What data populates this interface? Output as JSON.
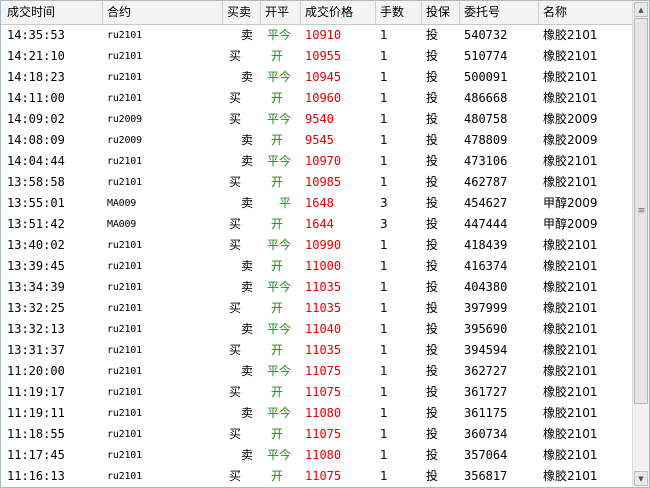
{
  "columns": [
    "成交时间",
    "合约",
    "买卖",
    "开平",
    "成交价格",
    "手数",
    "投保",
    "委托号",
    "名称"
  ],
  "rows": [
    {
      "time": "14:35:53",
      "contract": "ru2101",
      "side": "卖",
      "oc": "平今",
      "price": "10910",
      "qty": "1",
      "hedge": "投",
      "order_id": "540732",
      "name": "橡胶2101"
    },
    {
      "time": "14:21:10",
      "contract": "ru2101",
      "side": "买",
      "oc": "开",
      "price": "10955",
      "qty": "1",
      "hedge": "投",
      "order_id": "510774",
      "name": "橡胶2101"
    },
    {
      "time": "14:18:23",
      "contract": "ru2101",
      "side": "卖",
      "oc": "平今",
      "price": "10945",
      "qty": "1",
      "hedge": "投",
      "order_id": "500091",
      "name": "橡胶2101"
    },
    {
      "time": "14:11:00",
      "contract": "ru2101",
      "side": "买",
      "oc": "开",
      "price": "10960",
      "qty": "1",
      "hedge": "投",
      "order_id": "486668",
      "name": "橡胶2101"
    },
    {
      "time": "14:09:02",
      "contract": "ru2009",
      "side": "买",
      "oc": "平今",
      "price": "9540",
      "qty": "1",
      "hedge": "投",
      "order_id": "480758",
      "name": "橡胶2009"
    },
    {
      "time": "14:08:09",
      "contract": "ru2009",
      "side": "卖",
      "oc": "开",
      "price": "9545",
      "qty": "1",
      "hedge": "投",
      "order_id": "478809",
      "name": "橡胶2009"
    },
    {
      "time": "14:04:44",
      "contract": "ru2101",
      "side": "卖",
      "oc": "平今",
      "price": "10970",
      "qty": "1",
      "hedge": "投",
      "order_id": "473106",
      "name": "橡胶2101"
    },
    {
      "time": "13:58:58",
      "contract": "ru2101",
      "side": "买",
      "oc": "开",
      "price": "10985",
      "qty": "1",
      "hedge": "投",
      "order_id": "462787",
      "name": "橡胶2101"
    },
    {
      "time": "13:55:01",
      "contract": "MA009",
      "side": "卖",
      "oc": "平",
      "price": "1648",
      "qty": "3",
      "hedge": "投",
      "order_id": "454627",
      "name": "甲醇2009"
    },
    {
      "time": "13:51:42",
      "contract": "MA009",
      "side": "买",
      "oc": "开",
      "price": "1644",
      "qty": "3",
      "hedge": "投",
      "order_id": "447444",
      "name": "甲醇2009"
    },
    {
      "time": "13:40:02",
      "contract": "ru2101",
      "side": "买",
      "oc": "平今",
      "price": "10990",
      "qty": "1",
      "hedge": "投",
      "order_id": "418439",
      "name": "橡胶2101"
    },
    {
      "time": "13:39:45",
      "contract": "ru2101",
      "side": "卖",
      "oc": "开",
      "price": "11000",
      "qty": "1",
      "hedge": "投",
      "order_id": "416374",
      "name": "橡胶2101"
    },
    {
      "time": "13:34:39",
      "contract": "ru2101",
      "side": "卖",
      "oc": "平今",
      "price": "11035",
      "qty": "1",
      "hedge": "投",
      "order_id": "404380",
      "name": "橡胶2101"
    },
    {
      "time": "13:32:25",
      "contract": "ru2101",
      "side": "买",
      "oc": "开",
      "price": "11035",
      "qty": "1",
      "hedge": "投",
      "order_id": "397999",
      "name": "橡胶2101"
    },
    {
      "time": "13:32:13",
      "contract": "ru2101",
      "side": "卖",
      "oc": "平今",
      "price": "11040",
      "qty": "1",
      "hedge": "投",
      "order_id": "395690",
      "name": "橡胶2101"
    },
    {
      "time": "13:31:37",
      "contract": "ru2101",
      "side": "买",
      "oc": "开",
      "price": "11035",
      "qty": "1",
      "hedge": "投",
      "order_id": "394594",
      "name": "橡胶2101"
    },
    {
      "time": "11:20:00",
      "contract": "ru2101",
      "side": "卖",
      "oc": "平今",
      "price": "11075",
      "qty": "1",
      "hedge": "投",
      "order_id": "362727",
      "name": "橡胶2101"
    },
    {
      "time": "11:19:17",
      "contract": "ru2101",
      "side": "买",
      "oc": "开",
      "price": "11075",
      "qty": "1",
      "hedge": "投",
      "order_id": "361727",
      "name": "橡胶2101"
    },
    {
      "time": "11:19:11",
      "contract": "ru2101",
      "side": "卖",
      "oc": "平今",
      "price": "11080",
      "qty": "1",
      "hedge": "投",
      "order_id": "361175",
      "name": "橡胶2101"
    },
    {
      "time": "11:18:55",
      "contract": "ru2101",
      "side": "买",
      "oc": "开",
      "price": "11075",
      "qty": "1",
      "hedge": "投",
      "order_id": "360734",
      "name": "橡胶2101"
    },
    {
      "time": "11:17:45",
      "contract": "ru2101",
      "side": "卖",
      "oc": "平今",
      "price": "11080",
      "qty": "1",
      "hedge": "投",
      "order_id": "357064",
      "name": "橡胶2101"
    },
    {
      "time": "11:16:13",
      "contract": "ru2101",
      "side": "买",
      "oc": "开",
      "price": "11075",
      "qty": "1",
      "hedge": "投",
      "order_id": "356817",
      "name": "橡胶2101"
    }
  ],
  "colors": {
    "price": "#e00000",
    "open_close": "#1a8a1a",
    "header_bg": "#f4f4f4"
  },
  "scrollbar": {
    "up_icon": "arrow-up-icon",
    "down_icon": "arrow-down-icon",
    "grip_icon": "grip-icon"
  }
}
